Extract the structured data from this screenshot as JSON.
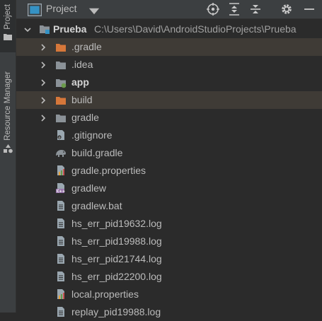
{
  "sidebar": {
    "project_tab": "Project",
    "resource_manager_tab": "Resource Manager"
  },
  "header": {
    "title": "Project",
    "icons": [
      "project-view-icon",
      "dropdown-icon",
      "locate-icon",
      "expand-all-icon",
      "collapse-all-icon",
      "gear-icon",
      "minimize-icon"
    ]
  },
  "tree": {
    "root": {
      "name": "Prueba",
      "path": "C:\\Users\\David\\AndroidStudioProjects\\Prueba"
    },
    "items": [
      {
        "label": ".gradle",
        "icon": "folder-orange-icon",
        "expandable": true
      },
      {
        "label": ".idea",
        "icon": "folder-icon",
        "expandable": true
      },
      {
        "label": "app",
        "icon": "module-folder-icon",
        "expandable": true
      },
      {
        "label": "build",
        "icon": "folder-orange-icon",
        "expandable": true
      },
      {
        "label": "gradle",
        "icon": "folder-icon",
        "expandable": true
      },
      {
        "label": ".gitignore",
        "icon": "gitignore-file-icon",
        "expandable": false
      },
      {
        "label": "build.gradle",
        "icon": "gradle-elephant-icon",
        "expandable": false
      },
      {
        "label": "gradle.properties",
        "icon": "properties-file-icon",
        "expandable": false
      },
      {
        "label": "gradlew",
        "icon": "script-file-icon",
        "expandable": false
      },
      {
        "label": "gradlew.bat",
        "icon": "text-file-icon",
        "expandable": false
      },
      {
        "label": "hs_err_pid19632.log",
        "icon": "text-file-icon",
        "expandable": false
      },
      {
        "label": "hs_err_pid19988.log",
        "icon": "text-file-icon",
        "expandable": false
      },
      {
        "label": "hs_err_pid21744.log",
        "icon": "text-file-icon",
        "expandable": false
      },
      {
        "label": "hs_err_pid22200.log",
        "icon": "text-file-icon",
        "expandable": false
      },
      {
        "label": "local.properties",
        "icon": "properties-file-icon",
        "expandable": false
      },
      {
        "label": "replay_pid19988.log",
        "icon": "text-file-icon",
        "expandable": false
      }
    ]
  },
  "colors": {
    "background": "#2b2b2b",
    "panel": "#3c3f41",
    "folder": "#8b9298",
    "folder_excluded": "#d6773a",
    "selection": "#3f3b36"
  }
}
